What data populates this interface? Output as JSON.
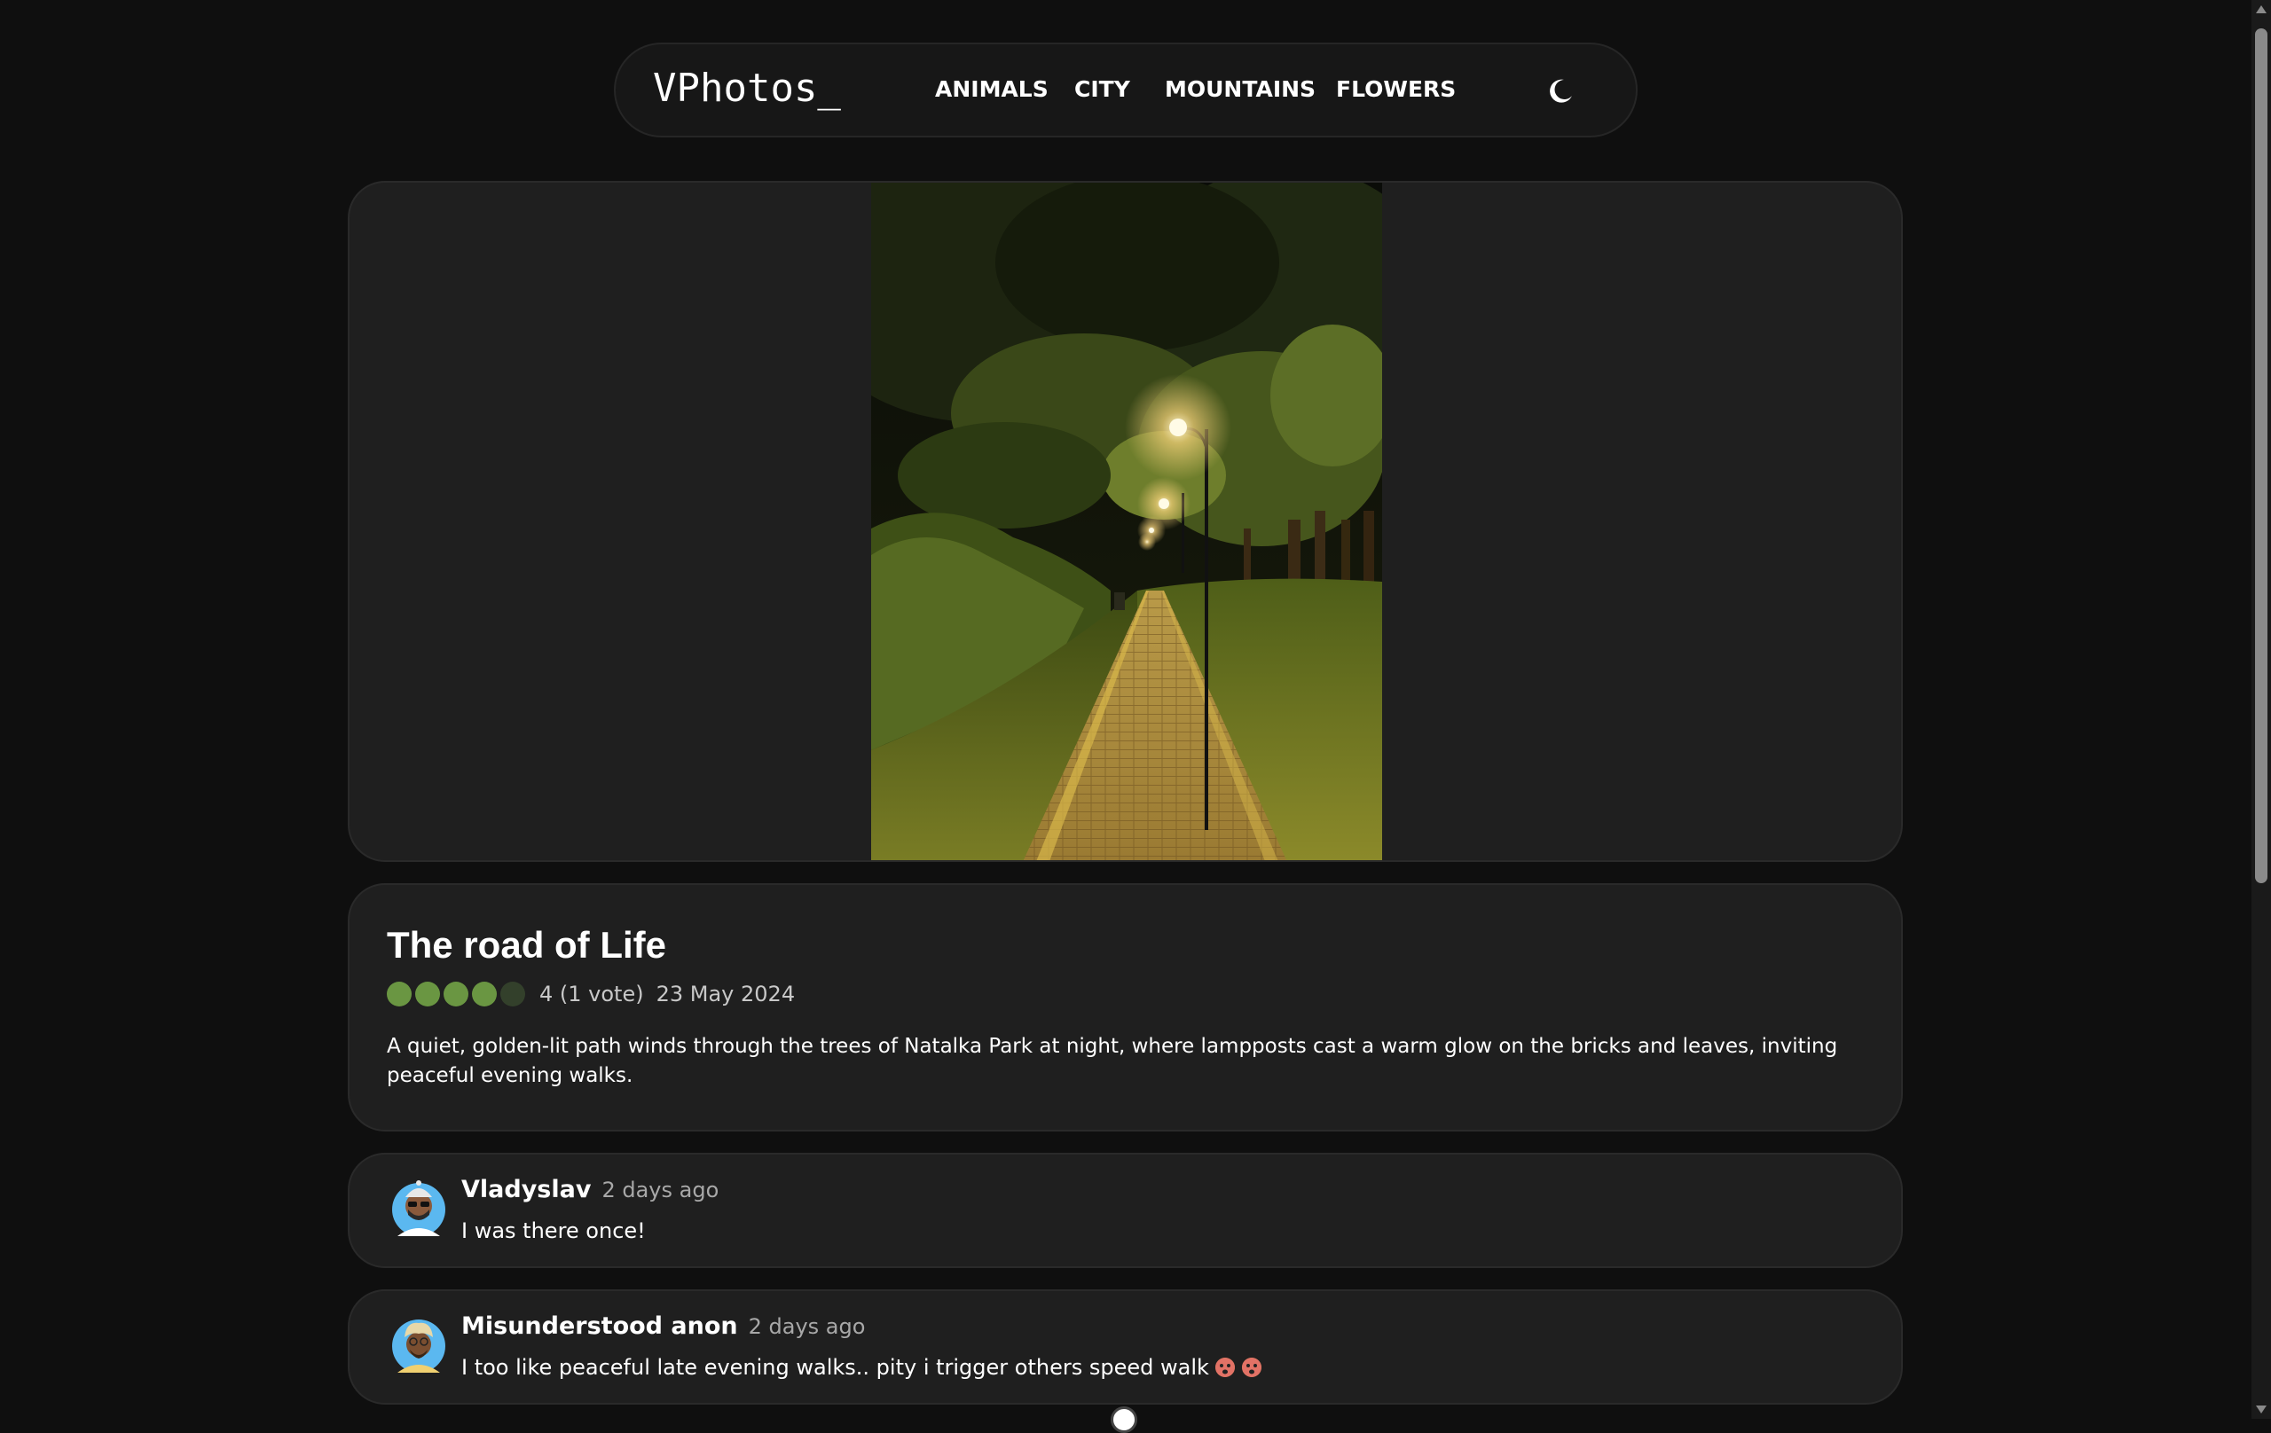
{
  "header": {
    "logo": "VPhotos_",
    "nav": [
      "ANIMALS",
      "CITY",
      "MOUNTAINS",
      "FLOWERS"
    ],
    "theme_icon": "moon-icon"
  },
  "photo": {
    "subject": "lit-park-path-photo"
  },
  "post": {
    "title": "The road of Life",
    "rating_value": 4,
    "rating_max": 5,
    "rating_text": "4 (1 vote)",
    "date": "23 May 2024",
    "description": "A quiet, golden-lit path winds through the trees of Natalka Park at night, where lampposts cast a warm glow on the bricks and leaves, inviting peaceful evening walks.",
    "rating_color_on": "#6a9642",
    "rating_color_off": "#33402b"
  },
  "comments": [
    {
      "author": "Vladyslav",
      "time": "2 days ago",
      "text": "I was there once!"
    },
    {
      "author": "Misunderstood anon",
      "time": "2 days ago",
      "text": "I too like peaceful late evening walks.. pity i trigger others speed walk"
    }
  ],
  "colors": {
    "background": "#0f0f0f",
    "card": "#1f1f1f",
    "text": "#ffffff",
    "muted": "#a8a8a8"
  }
}
